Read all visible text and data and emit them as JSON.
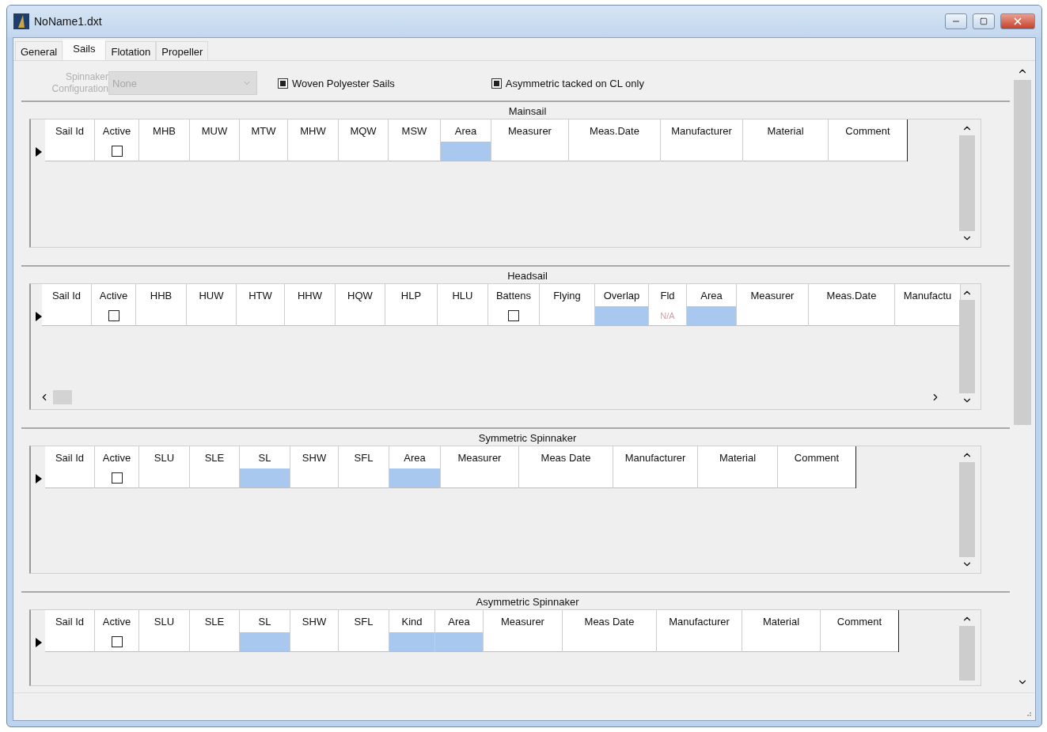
{
  "window": {
    "title": "NoName1.dxt"
  },
  "tabs": [
    {
      "label": "General",
      "selected": false
    },
    {
      "label": "Sails",
      "selected": true
    },
    {
      "label": "Flotation",
      "selected": false
    },
    {
      "label": "Propeller",
      "selected": false
    }
  ],
  "options": {
    "spinnaker_configuration": {
      "label": "Spinnaker Configuration",
      "value": "None",
      "disabled": true
    },
    "checkboxes": [
      {
        "label": "Woven Polyester Sails",
        "checked": true
      },
      {
        "label": "Asymmetric tacked on CL only",
        "checked": true
      }
    ]
  },
  "sections": [
    {
      "title": "Mainsail",
      "horizontal_scroll": false,
      "columns": [
        {
          "label": "Sail Id",
          "kind": "text",
          "highlighted": false
        },
        {
          "label": "Active",
          "kind": "check",
          "checked": false
        },
        {
          "label": "MHB",
          "kind": "text",
          "highlighted": false
        },
        {
          "label": "MUW",
          "kind": "text",
          "highlighted": false
        },
        {
          "label": "MTW",
          "kind": "text",
          "highlighted": false
        },
        {
          "label": "MHW",
          "kind": "text",
          "highlighted": false
        },
        {
          "label": "MQW",
          "kind": "text",
          "highlighted": false
        },
        {
          "label": "MSW",
          "kind": "text",
          "highlighted": false
        },
        {
          "label": "Area",
          "kind": "text",
          "highlighted": true
        },
        {
          "label": "Measurer",
          "kind": "text",
          "highlighted": false
        },
        {
          "label": "Meas.Date",
          "kind": "text",
          "highlighted": false
        },
        {
          "label": "Manufacturer",
          "kind": "text",
          "highlighted": false
        },
        {
          "label": "Material",
          "kind": "text",
          "highlighted": false
        },
        {
          "label": "Comment",
          "kind": "text",
          "highlighted": false
        }
      ]
    },
    {
      "title": "Headsail",
      "horizontal_scroll": true,
      "columns": [
        {
          "label": "Sail Id",
          "kind": "text",
          "highlighted": false
        },
        {
          "label": "Active",
          "kind": "check",
          "checked": false
        },
        {
          "label": "HHB",
          "kind": "text",
          "highlighted": false
        },
        {
          "label": "HUW",
          "kind": "text",
          "highlighted": false
        },
        {
          "label": "HTW",
          "kind": "text",
          "highlighted": false
        },
        {
          "label": "HHW",
          "kind": "text",
          "highlighted": false
        },
        {
          "label": "HQW",
          "kind": "text",
          "highlighted": false
        },
        {
          "label": "HLP",
          "kind": "text",
          "highlighted": false
        },
        {
          "label": "HLU",
          "kind": "text",
          "highlighted": false
        },
        {
          "label": "Battens",
          "kind": "check",
          "checked": false
        },
        {
          "label": "Flying",
          "kind": "text",
          "highlighted": false
        },
        {
          "label": "Overlap",
          "kind": "text",
          "highlighted": true
        },
        {
          "label": "Fld",
          "kind": "text",
          "highlighted": false,
          "value": "N/A"
        },
        {
          "label": "Area",
          "kind": "text",
          "highlighted": true
        },
        {
          "label": "Measurer",
          "kind": "text",
          "highlighted": false
        },
        {
          "label": "Meas.Date",
          "kind": "text",
          "highlighted": false
        },
        {
          "label": "Manufactu",
          "kind": "text",
          "highlighted": false
        }
      ]
    },
    {
      "title": "Symmetric Spinnaker",
      "horizontal_scroll": false,
      "columns": [
        {
          "label": "Sail Id",
          "kind": "text",
          "highlighted": false
        },
        {
          "label": "Active",
          "kind": "check",
          "checked": false
        },
        {
          "label": "SLU",
          "kind": "text",
          "highlighted": false
        },
        {
          "label": "SLE",
          "kind": "text",
          "highlighted": false
        },
        {
          "label": "SL",
          "kind": "text",
          "highlighted": true
        },
        {
          "label": "SHW",
          "kind": "text",
          "highlighted": false
        },
        {
          "label": "SFL",
          "kind": "text",
          "highlighted": false
        },
        {
          "label": "Area",
          "kind": "text",
          "highlighted": true
        },
        {
          "label": "Measurer",
          "kind": "text",
          "highlighted": false
        },
        {
          "label": "Meas Date",
          "kind": "text",
          "highlighted": false
        },
        {
          "label": "Manufacturer",
          "kind": "text",
          "highlighted": false
        },
        {
          "label": "Material",
          "kind": "text",
          "highlighted": false
        },
        {
          "label": "Comment",
          "kind": "text",
          "highlighted": false
        }
      ]
    },
    {
      "title": "Asymmetric Spinnaker",
      "horizontal_scroll": false,
      "columns": [
        {
          "label": "Sail Id",
          "kind": "text",
          "highlighted": false
        },
        {
          "label": "Active",
          "kind": "check",
          "checked": false
        },
        {
          "label": "SLU",
          "kind": "text",
          "highlighted": false
        },
        {
          "label": "SLE",
          "kind": "text",
          "highlighted": false
        },
        {
          "label": "SL",
          "kind": "text",
          "highlighted": true
        },
        {
          "label": "SHW",
          "kind": "text",
          "highlighted": false
        },
        {
          "label": "SFL",
          "kind": "text",
          "highlighted": false
        },
        {
          "label": "Kind",
          "kind": "text",
          "highlighted": true
        },
        {
          "label": "Area",
          "kind": "text",
          "highlighted": true
        },
        {
          "label": "Measurer",
          "kind": "text",
          "highlighted": false
        },
        {
          "label": "Meas Date",
          "kind": "text",
          "highlighted": false
        },
        {
          "label": "Manufacturer",
          "kind": "text",
          "highlighted": false
        },
        {
          "label": "Material",
          "kind": "text",
          "highlighted": false
        },
        {
          "label": "Comment",
          "kind": "text",
          "highlighted": false
        }
      ]
    }
  ]
}
